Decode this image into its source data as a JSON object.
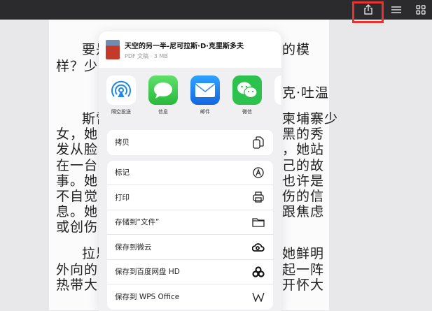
{
  "toolbar": {
    "share_icon": "share-icon",
    "list_icon": "list-icon",
    "grid_icon": "grid-icon"
  },
  "book_lines": [
    {
      "left": "要是",
      "right": "的模"
    },
    {
      "left": "样？少之",
      "right": ""
    },
    {
      "left": "",
      "right": "克·吐温"
    },
    {
      "left": "斯雷",
      "right": "柬埔寨少"
    },
    {
      "left": "女，她在",
      "right": "黑的秀"
    },
    {
      "left": "发从脸上",
      "right": "，她站"
    },
    {
      "left": "在一台导",
      "right": "己的故"
    },
    {
      "left": "事。她不",
      "right": "也许是"
    },
    {
      "left": "不自觉的",
      "right": "伤的信"
    },
    {
      "left": "息。她们",
      "right": "跟焦虑"
    },
    {
      "left": "或创伤不",
      "right": ""
    },
    {
      "left": "拉思",
      "right": "她鲜明"
    },
    {
      "left": "外向的人",
      "right": "起一阵"
    },
    {
      "left": "热带大雨，",
      "right": "开怀大"
    }
  ],
  "share": {
    "title": "天空的另一半-尼可拉斯·D·克里斯多夫",
    "subtitle": "PDF 文稿 · 3 MB",
    "apps": [
      {
        "label": "隔空投送",
        "icon": "airdrop-icon"
      },
      {
        "label": "信息",
        "icon": "messages-icon"
      },
      {
        "label": "邮件",
        "icon": "mail-icon"
      },
      {
        "label": "微信",
        "icon": "wechat-icon"
      }
    ],
    "copy": "拷贝",
    "actions": [
      "标记",
      "打印",
      "存储到“文件”",
      "保存到微云",
      "保存到百度网盘 HD",
      "保存到 WPS Office"
    ]
  }
}
